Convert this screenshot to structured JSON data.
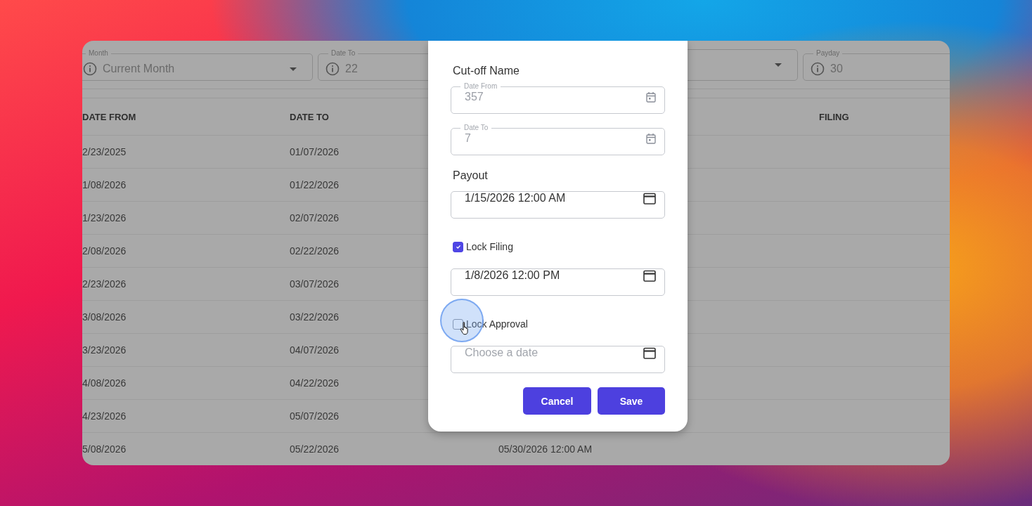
{
  "filters": [
    {
      "kind": "select",
      "label": "Month",
      "value": "Current Month"
    },
    {
      "kind": "number",
      "label": "Date To",
      "value": "22"
    },
    {
      "kind": "select"
    },
    {
      "kind": "number",
      "label": "Payday",
      "value": "30"
    }
  ],
  "table": {
    "columns": [
      "DATE FROM",
      "DATE TO",
      "",
      "FILING"
    ],
    "rows": [
      {
        "date_from": "2/23/2025",
        "date_to": "01/07/2026"
      },
      {
        "date_from": "1/08/2026",
        "date_to": "01/22/2026"
      },
      {
        "date_from": "1/23/2026",
        "date_to": "02/07/2026"
      },
      {
        "date_from": "2/08/2026",
        "date_to": "02/22/2026"
      },
      {
        "date_from": "2/23/2026",
        "date_to": "03/07/2026"
      },
      {
        "date_from": "3/08/2026",
        "date_to": "03/22/2026"
      },
      {
        "date_from": "3/23/2026",
        "date_to": "04/07/2026"
      },
      {
        "date_from": "4/08/2026",
        "date_to": "04/22/2026"
      },
      {
        "date_from": "4/23/2026",
        "date_to": "05/07/2026"
      },
      {
        "date_from": "5/08/2026",
        "date_to": "05/22/2026",
        "column_3": "05/30/2026 12:00 AM"
      }
    ]
  },
  "dialog": {
    "items": [
      {
        "kind": "heading",
        "text": "Cut-off Name"
      },
      {
        "kind": "field",
        "label": "Date From",
        "value": "357",
        "disabled": true
      },
      {
        "kind": "field",
        "label": "Date To",
        "value": "7",
        "disabled": true
      },
      {
        "kind": "heading",
        "text": "Payout"
      },
      {
        "kind": "field",
        "value": "1/15/2026 12:00 AM",
        "disabled": false
      },
      {
        "kind": "checkbox",
        "text": "Lock Filing",
        "checked": true
      },
      {
        "kind": "field",
        "value": "1/8/2026 12:00 PM",
        "disabled": false
      },
      {
        "kind": "checkbox",
        "text": "Lock Approval",
        "checked": false
      },
      {
        "kind": "field",
        "placeholder": "Choose a date",
        "disabled": false
      }
    ],
    "buttons": [
      "Cancel",
      "Save"
    ]
  }
}
